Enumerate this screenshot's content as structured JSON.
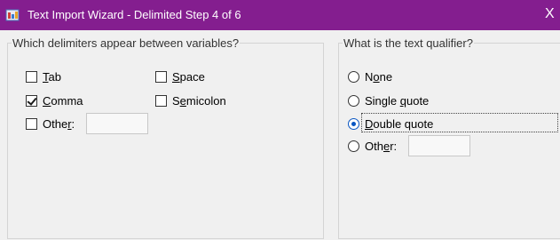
{
  "window": {
    "title": "Text Import Wizard - Delimited Step 4 of 6",
    "titlebar_color": "#841e8f",
    "close_glyph": "X"
  },
  "delimiters": {
    "legend": "Which delimiters appear between variables?",
    "items": [
      {
        "label_pre": "",
        "accel": "T",
        "label_post": "ab",
        "checked": false
      },
      {
        "label_pre": "",
        "accel": "S",
        "label_post": "pace",
        "checked": false
      },
      {
        "label_pre": "",
        "accel": "C",
        "label_post": "omma",
        "checked": true
      },
      {
        "label_pre": "S",
        "accel": "e",
        "label_post": "micolon",
        "checked": false
      },
      {
        "label_pre": "Othe",
        "accel": "r",
        "label_post": ":",
        "checked": false
      }
    ],
    "other_value": ""
  },
  "qualifier": {
    "legend": "What is the text qualifier?",
    "items": [
      {
        "label_pre": "N",
        "accel": "o",
        "label_post": "ne",
        "selected": false
      },
      {
        "label_pre": "Single ",
        "accel": "q",
        "label_post": "uote",
        "selected": false
      },
      {
        "label_pre": "",
        "accel": "D",
        "label_post": "ouble quote",
        "selected": true
      },
      {
        "label_pre": "Oth",
        "accel": "e",
        "label_post": "r:",
        "selected": false
      }
    ],
    "other_value": ""
  }
}
